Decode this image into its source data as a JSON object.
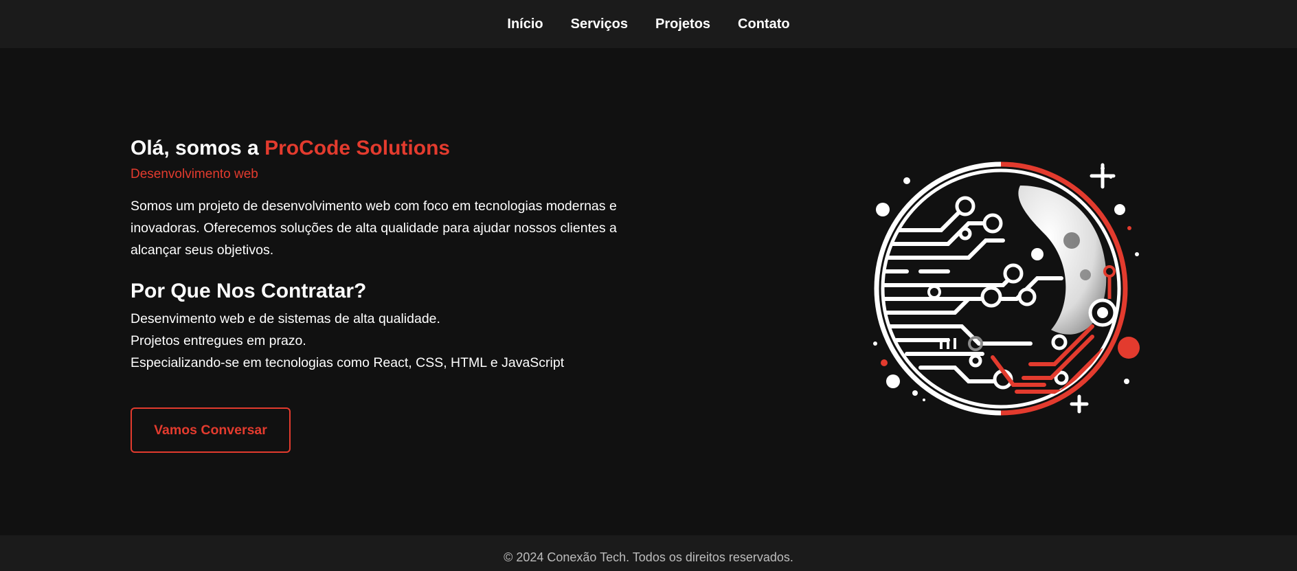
{
  "nav": {
    "items": [
      {
        "label": "Início"
      },
      {
        "label": "Serviços"
      },
      {
        "label": "Projetos"
      },
      {
        "label": "Contato"
      }
    ]
  },
  "hero": {
    "title_prefix": "Olá, somos a ",
    "title_brand": "ProCode Solutions",
    "subtitle": "Desenvolvimento web",
    "description": "Somos um projeto de desenvolvimento web com foco em tecnologias modernas e inovadoras. Oferecemos soluções de alta qualidade para ajudar nossos clientes a alcançar seus objetivos.",
    "why_title": "Por Que Nos Contratar?",
    "why_items": [
      "Desenvimento web e de sistemas de alta qualidade.",
      "Projetos entregues em prazo.",
      "Especializando-se em tecnologias como React, CSS, HTML e JavaScript"
    ],
    "cta_label": "Vamos Conversar"
  },
  "illustration": {
    "icon": "circuit-globe-icon",
    "accent_color": "#e33b2e"
  },
  "footer": {
    "text": "© 2024 Conexão Tech. Todos os direitos reservados."
  },
  "colors": {
    "background": "#111111",
    "bar": "#1b1b1b",
    "accent": "#e33b2e",
    "text": "#ffffff"
  }
}
